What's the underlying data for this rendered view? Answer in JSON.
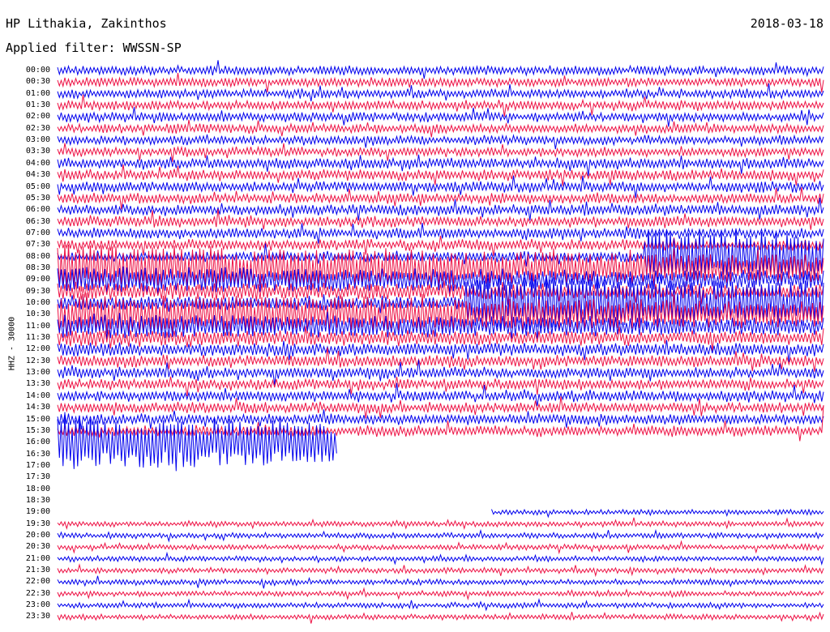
{
  "header": {
    "station": "HP Lithakia, Zakinthos",
    "date": "2018-03-18",
    "filter": "Applied filter: WWSSN-SP"
  },
  "side_label": "HHZ - 30000",
  "chart_data": {
    "type": "helicorder",
    "title": "HP Lithakia, Zakinthos",
    "subtitle": "Applied filter: WWSSN-SP",
    "channel_label": "HHZ - 30000",
    "date": "2018-03-18",
    "row_labels": [
      "00:00",
      "00:30",
      "01:00",
      "01:30",
      "02:00",
      "02:30",
      "03:00",
      "03:30",
      "04:00",
      "04:30",
      "05:00",
      "05:30",
      "06:00",
      "06:30",
      "07:00",
      "07:30",
      "08:00",
      "08:30",
      "09:00",
      "09:30",
      "10:00",
      "10:30",
      "11:00",
      "11:30",
      "12:00",
      "12:30",
      "13:00",
      "13:30",
      "14:00",
      "14:30",
      "15:00",
      "15:30",
      "16:00",
      "16:30",
      "17:00",
      "17:30",
      "18:00",
      "18:30",
      "19:00",
      "19:30",
      "20:00",
      "20:30",
      "21:00",
      "21:30",
      "22:00",
      "22:30",
      "23:00",
      "23:30"
    ],
    "row_minutes": 30,
    "trace_colors": [
      "#0000ee",
      "#ee1144"
    ],
    "data_gap": {
      "start": "16:11",
      "end": "19:17"
    },
    "strong_events": [
      "08:23",
      "10:16",
      "16:00"
    ],
    "noise_level": "high in morning rows, lower after gap"
  }
}
